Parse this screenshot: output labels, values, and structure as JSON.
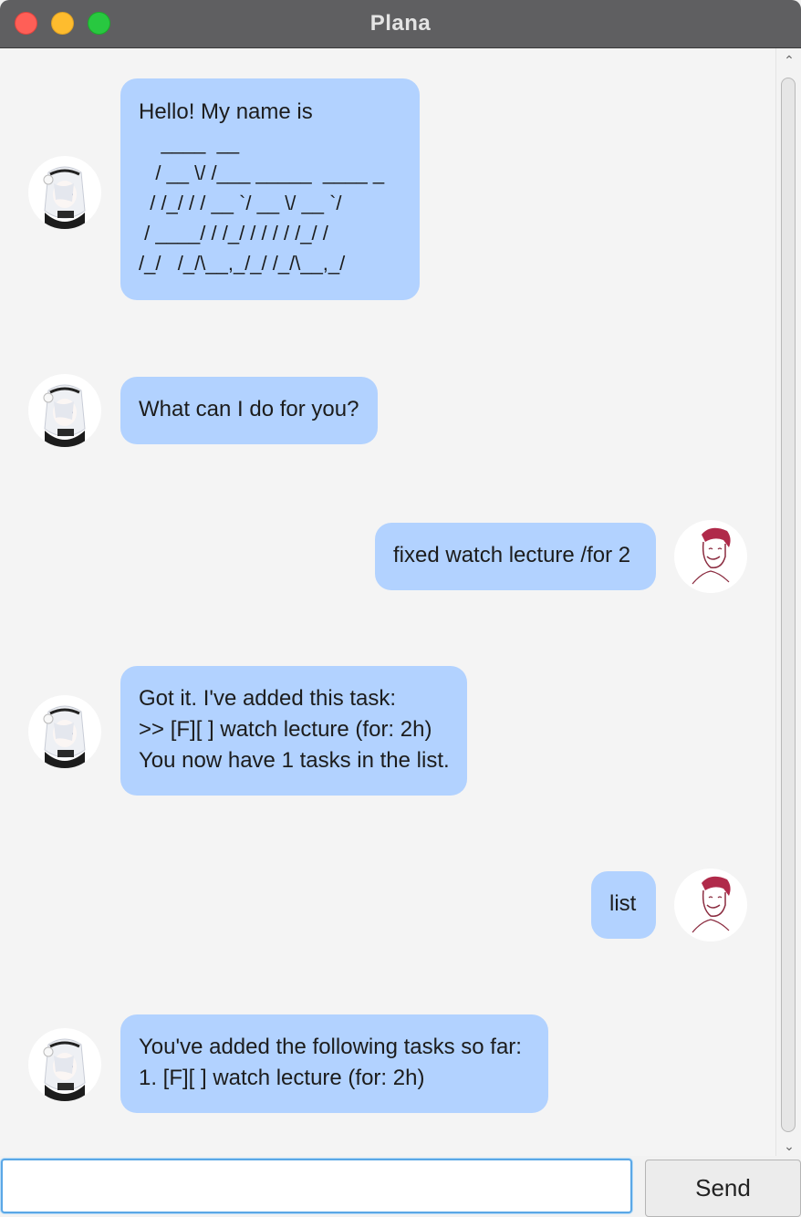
{
  "window": {
    "title": "Plana"
  },
  "messages": {
    "m1": {
      "sender": "bot",
      "lines": [
        "Hello! My name is",
        "    ____  __",
        "   / __ \\/ /___ _____  ____ _",
        "  / /_/ / / __ `/ __ \\/ __ `/",
        " / ____/ / /_/ / / / / /_/ /",
        "/_/   /_/\\__,_/_/ /_/\\__,_/"
      ]
    },
    "m2": {
      "sender": "bot",
      "lines": [
        "What can I do for you?"
      ]
    },
    "m3": {
      "sender": "user",
      "lines": [
        "fixed watch lecture /for 2"
      ]
    },
    "m4": {
      "sender": "bot",
      "lines": [
        "Got it. I've added this task:",
        ">> [F][ ] watch lecture (for: 2h)",
        "You now have 1 tasks in the list."
      ]
    },
    "m5": {
      "sender": "user",
      "lines": [
        "list"
      ]
    },
    "m6": {
      "sender": "bot",
      "lines": [
        "You've added the following tasks so far:",
        "1. [F][ ] watch lecture (for: 2h)"
      ]
    }
  },
  "input": {
    "value": "",
    "placeholder": ""
  },
  "send_button": {
    "label": "Send"
  },
  "colors": {
    "bubble": "#b2d2ff",
    "chat_bg": "#f4f4f4",
    "titlebar": "#5f5f61"
  }
}
